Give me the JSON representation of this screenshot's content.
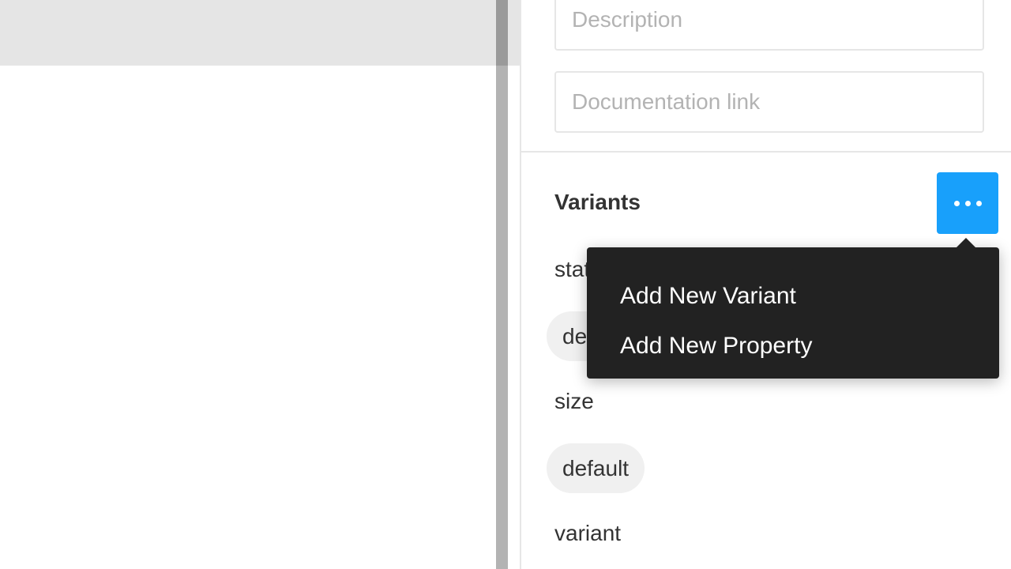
{
  "panel": {
    "description_placeholder": "Description",
    "documentation_placeholder": "Documentation link",
    "variants_title": "Variants",
    "more_button_icon": "more-horizontal-icon",
    "properties": [
      {
        "name": "state",
        "value": "default"
      },
      {
        "name": "size",
        "value": "default"
      },
      {
        "name": "variant",
        "value": ""
      }
    ]
  },
  "menu": {
    "items": [
      {
        "label": "Add New Variant"
      },
      {
        "label": "Add New Property"
      }
    ]
  },
  "colors": {
    "accent": "#18a0fb",
    "menu_bg": "#222222",
    "pill_bg": "#f0f0f0",
    "canvas_bar": "#e5e5e5",
    "scrollbar": "#b3b3b3"
  }
}
